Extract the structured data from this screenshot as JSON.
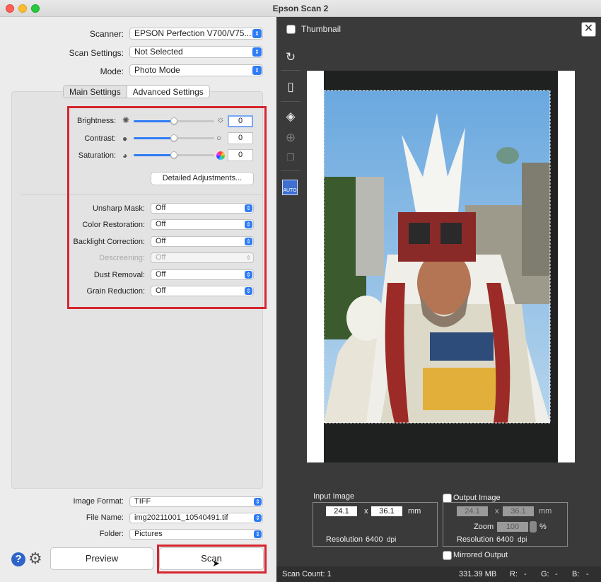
{
  "window": {
    "title": "Epson Scan 2"
  },
  "top": {
    "scanner_label": "Scanner:",
    "scanner_value": "EPSON Perfection V700/V75...",
    "scan_settings_label": "Scan Settings:",
    "scan_settings_value": "Not Selected",
    "mode_label": "Mode:",
    "mode_value": "Photo Mode"
  },
  "tabs": [
    {
      "label": "Main Settings",
      "active": true
    },
    {
      "label": "Advanced Settings",
      "active": false
    }
  ],
  "adjust": {
    "brightness_label": "Brightness:",
    "brightness_value": "0",
    "brightness_level": 0.5,
    "contrast_label": "Contrast:",
    "contrast_value": "0",
    "contrast_level": 0.5,
    "saturation_label": "Saturation:",
    "saturation_value": "0",
    "saturation_level": 0.5,
    "detailed_button": "Detailed Adjustments..."
  },
  "options": [
    {
      "label": "Unsharp Mask:",
      "value": "Off",
      "enabled": true
    },
    {
      "label": "Color Restoration:",
      "value": "Off",
      "enabled": true
    },
    {
      "label": "Backlight Correction:",
      "value": "Off",
      "enabled": true
    },
    {
      "label": "Descreening:",
      "value": "Off",
      "enabled": false
    },
    {
      "label": "Dust Removal:",
      "value": "Off",
      "enabled": true
    },
    {
      "label": "Grain Reduction:",
      "value": "Off",
      "enabled": true
    }
  ],
  "output": {
    "format_label": "Image Format:",
    "format_value": "TIFF",
    "filename_label": "File Name:",
    "filename_value": "img20211001_10540491.tif",
    "folder_label": "Folder:",
    "folder_value": "Pictures"
  },
  "buttons": {
    "preview": "Preview",
    "scan": "Scan"
  },
  "right": {
    "thumbnail_label": "Thumbnail",
    "input_image": {
      "title": "Input Image",
      "width": "24.1",
      "x": "x",
      "height": "36.1",
      "unit": "mm",
      "resolution_label": "Resolution",
      "resolution_value": "6400",
      "resolution_unit": "dpi"
    },
    "output_image": {
      "title": "Output Image",
      "width": "24.1",
      "x": "x",
      "height": "36.1",
      "unit": "mm",
      "zoom_label": "Zoom",
      "zoom_value": "100",
      "zoom_unit": "%",
      "resolution_label": "Resolution",
      "resolution_value": "6400",
      "resolution_unit": "dpi"
    },
    "mirrored_label": "Mirrored Output",
    "status": {
      "scan_count": "Scan Count: 1",
      "size": "331.39 MB",
      "r": "R:",
      "r_val": "-",
      "g": "G:",
      "g_val": "-",
      "b": "B:",
      "b_val": "-"
    },
    "auto_label": "AUTO"
  },
  "colors": {
    "accent": "#2f7cf6",
    "highlight_box": "#d6252f",
    "dark_panel": "#3a3a3a"
  },
  "icons": [
    "sun-low-icon",
    "sun-high-icon",
    "contrast-low-icon",
    "contrast-high-icon",
    "saturation-low-icon",
    "color-wheel-icon",
    "rotate-icon",
    "document-icon",
    "auto-crop-icon",
    "add-marquee-icon",
    "copy-icon",
    "auto-exposure-icon",
    "help-icon",
    "gear-icon",
    "close-icon"
  ]
}
